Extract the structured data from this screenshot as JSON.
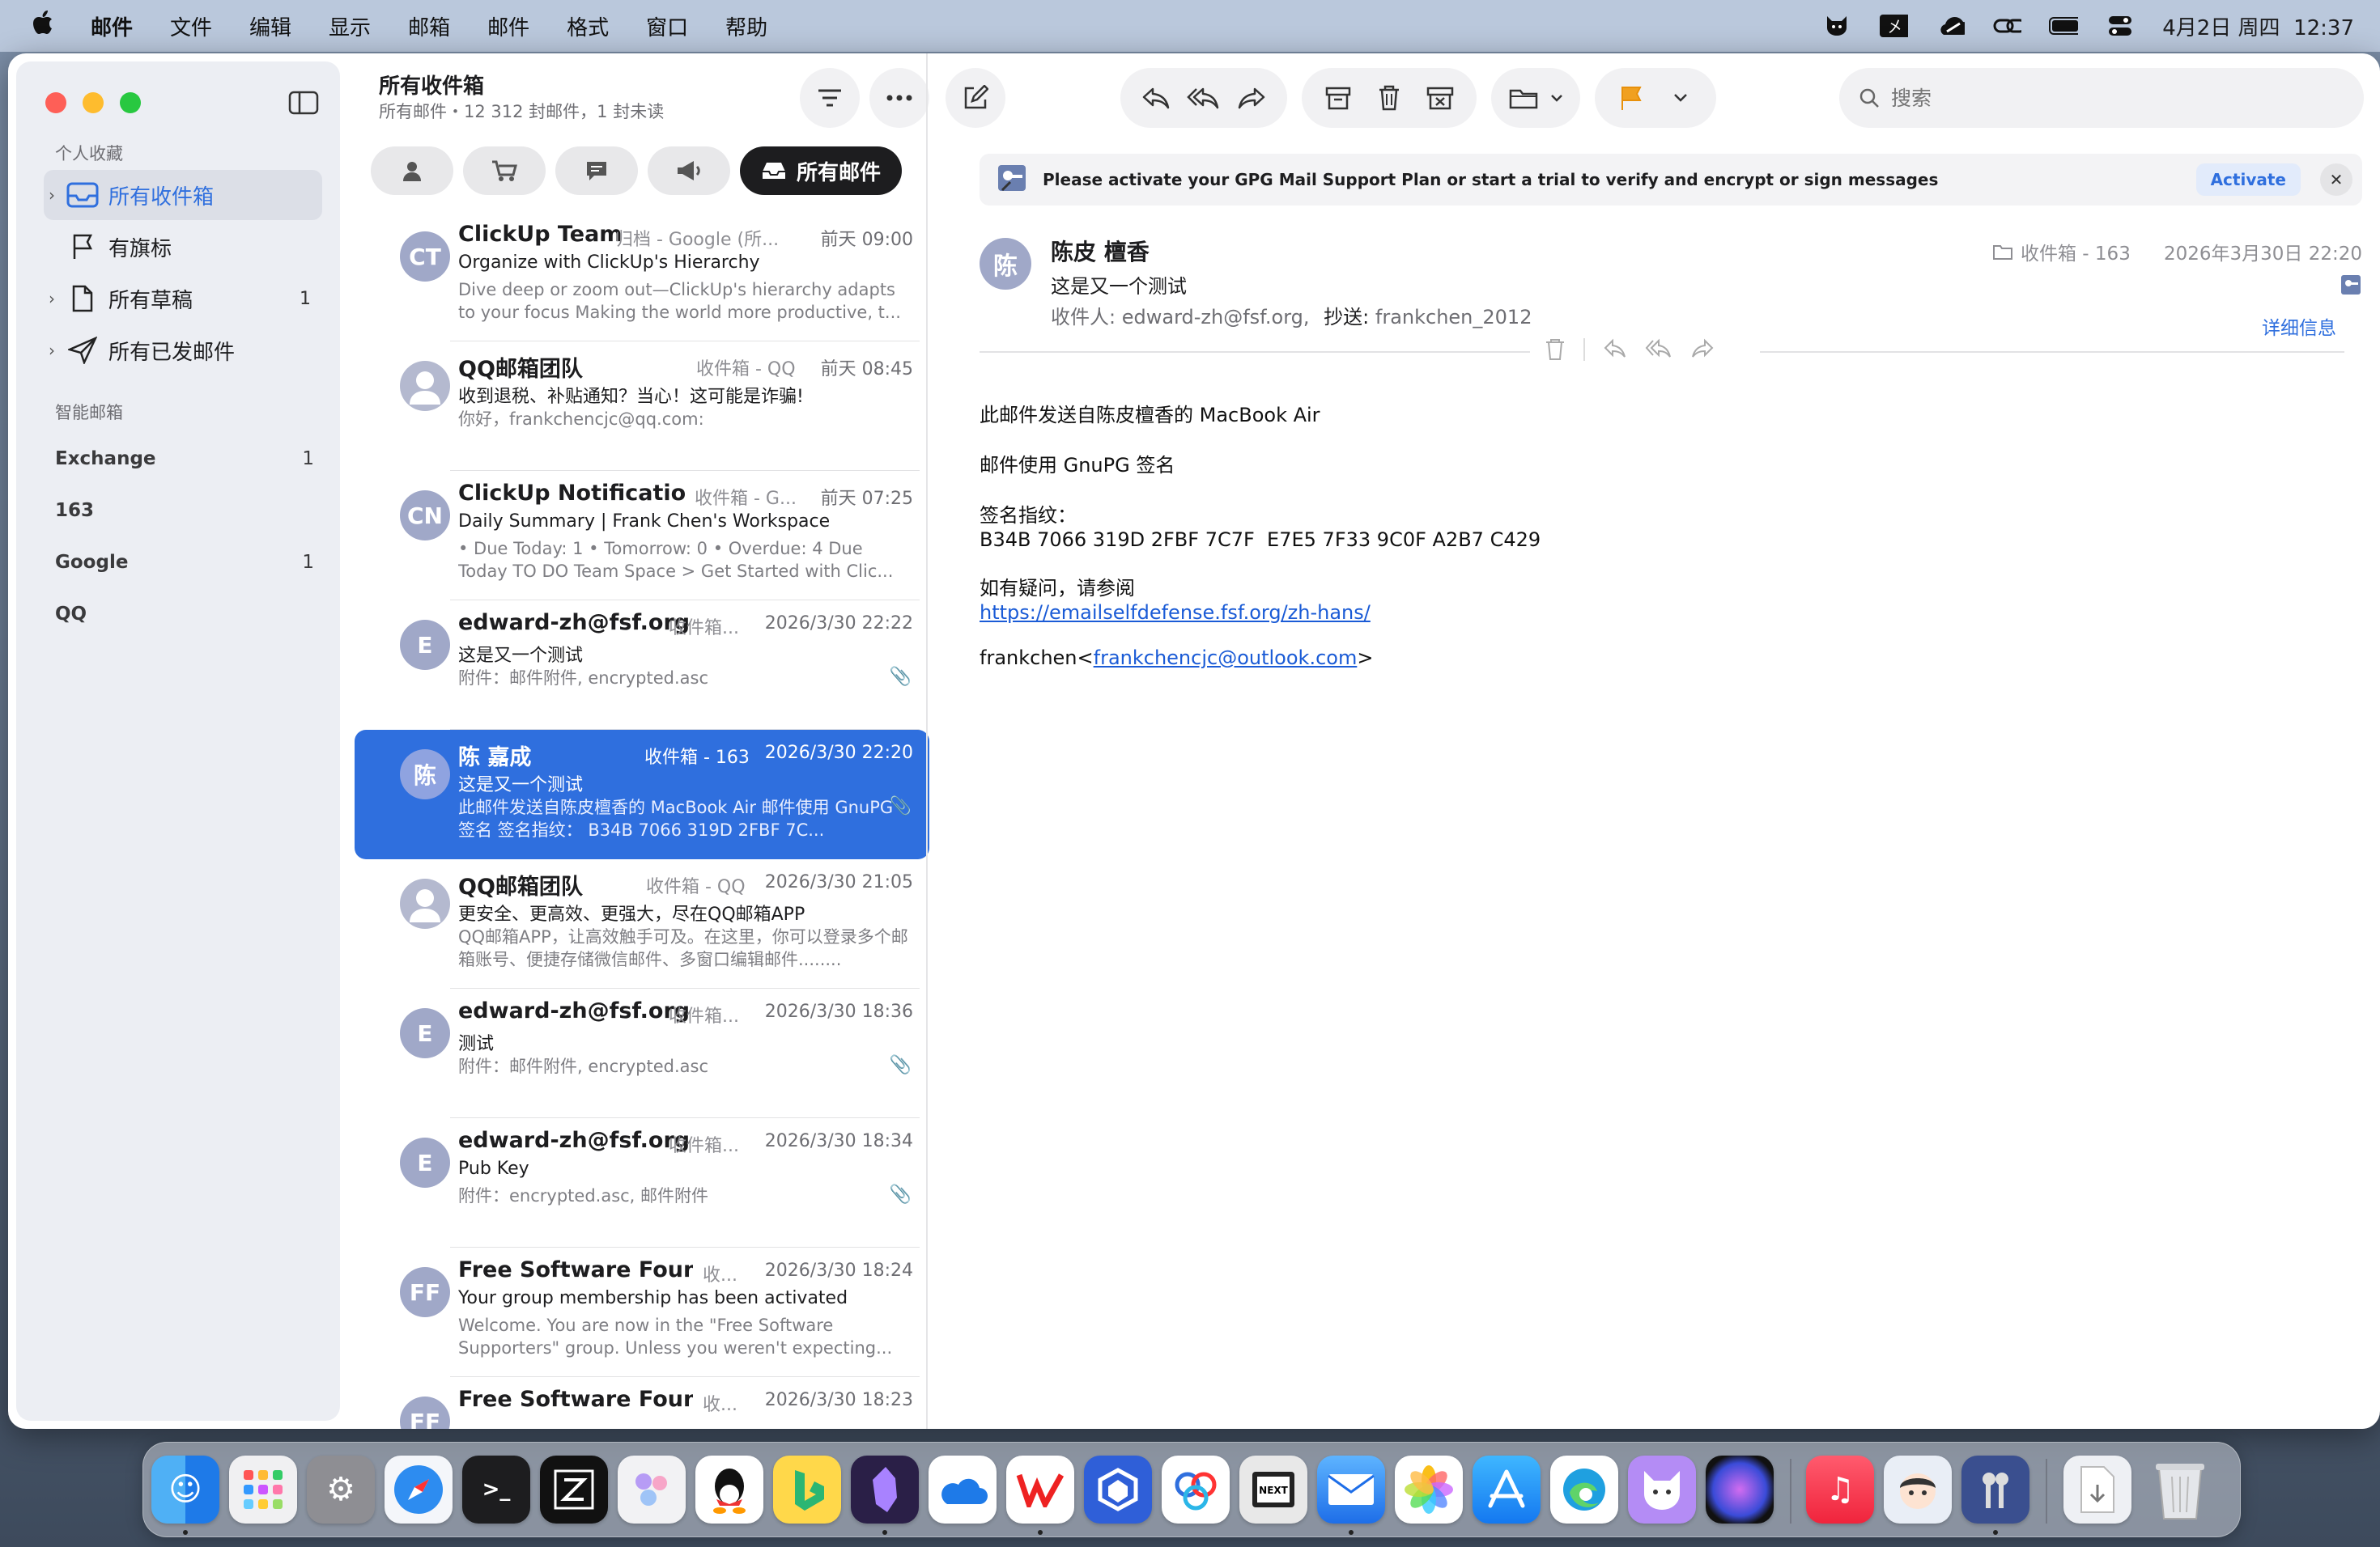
{
  "menubar": {
    "apple": "",
    "items": [
      "邮件",
      "文件",
      "编辑",
      "显示",
      "邮箱",
      "邮件",
      "格式",
      "窗口",
      "帮助"
    ],
    "datetime": "4月2日 周四  12:37",
    "status_icons": [
      "cat-icon",
      "input-method-icon",
      "cloud-icon",
      "link-icon",
      "battery-icon",
      "control-center-icon"
    ]
  },
  "sidebar": {
    "favorites_header": "个人收藏",
    "favorites": [
      {
        "label": "所有收件箱",
        "count": "",
        "icon": "inbox-icon"
      },
      {
        "label": "有旗标",
        "count": "",
        "icon": "flag-icon"
      },
      {
        "label": "所有草稿",
        "count": "1",
        "icon": "document-icon"
      },
      {
        "label": "所有已发邮件",
        "count": "",
        "icon": "paperplane-icon"
      }
    ],
    "smart_header": "智能邮箱",
    "accounts": [
      {
        "label": "Exchange",
        "count": "1"
      },
      {
        "label": "163",
        "count": ""
      },
      {
        "label": "Google",
        "count": "1"
      },
      {
        "label": "QQ",
        "count": ""
      }
    ]
  },
  "list": {
    "title": "所有收件箱",
    "subtitle": "所有邮件・12 312 封邮件，1 封未读",
    "active_category": "所有邮件",
    "categories": [
      "person-icon",
      "cart-icon",
      "chat-icon",
      "megaphone-icon",
      "inbox-tray-icon"
    ],
    "messages": [
      {
        "avatar": "CT",
        "from": "ClickUp Team",
        "mailbox": "归档 - Google (所...",
        "date": "前天 09:00",
        "subject": "Organize with ClickUp's Hierarchy",
        "preview": "Dive deep or zoom out—ClickUp's hierarchy adapts to your focus Making the world more productive, t...",
        "attachment": false
      },
      {
        "avatar": "",
        "from": "QQ邮箱团队",
        "mailbox": "收件箱 - QQ",
        "date": "前天 08:45",
        "subject": "收到退税、补贴通知？当心！这可能是诈骗!",
        "preview": "你好，frankchencjc@qq.com:",
        "attachment": false
      },
      {
        "avatar": "CN",
        "from": "ClickUp Notifications",
        "mailbox": "收件箱 - G...",
        "date": "前天 07:25",
        "subject": "Daily Summary | Frank Chen's Workspace",
        "preview": "• Due Today: 1 • Tomorrow: 0 • Overdue: 4 Due Today TO DO Team Space > Get Started with Clic...",
        "attachment": false
      },
      {
        "avatar": "E",
        "from": "edward-zh@fsf.org",
        "mailbox": "收件箱...",
        "date": "2026/3/30 22:22",
        "subject": "这是又一个测试",
        "preview": "附件：邮件附件, encrypted.asc",
        "attachment": true
      },
      {
        "avatar": "陈",
        "from": "陈 嘉成",
        "mailbox": "收件箱 - 163",
        "date": "2026/3/30 22:20",
        "subject": "这是又一个测试",
        "preview": "此邮件发送自陈皮檀香的 MacBook Air 邮件使用 GnuPG 签名 签名指纹： B34B 7066 319D 2FBF 7C...",
        "attachment": true
      },
      {
        "avatar": "",
        "from": "QQ邮箱团队",
        "mailbox": "收件箱 - QQ",
        "date": "2026/3/30 21:05",
        "subject": "更安全、更高效、更强大，尽在QQ邮箱APP",
        "preview": "QQ邮箱APP，让高效触手可及。在这里，你可以登录多个邮箱账号、便捷存储微信邮件、多窗口编辑邮件........",
        "attachment": false
      },
      {
        "avatar": "E",
        "from": "edward-zh@fsf.org",
        "mailbox": "收件箱...",
        "date": "2026/3/30 18:36",
        "subject": "测试",
        "preview": "附件：邮件附件, encrypted.asc",
        "attachment": true
      },
      {
        "avatar": "E",
        "from": "edward-zh@fsf.org",
        "mailbox": "收件箱...",
        "date": "2026/3/30 18:34",
        "subject": "Pub Key",
        "preview": "附件：encrypted.asc, 邮件附件",
        "attachment": true
      },
      {
        "avatar": "FF",
        "from": "Free Software Foun...",
        "mailbox": "收...",
        "date": "2026/3/30 18:24",
        "subject": "Your group membership has been activated",
        "preview": "Welcome. You are now in the \"Free Software Supporters\" group. Unless you weren't expecting...",
        "attachment": false
      },
      {
        "avatar": "FF",
        "from": "Free Software Foun...",
        "mailbox": "收...",
        "date": "2026/3/30 18:23",
        "subject": "",
        "preview": "",
        "attachment": false
      }
    ]
  },
  "reader": {
    "search_placeholder": "搜索",
    "banner": {
      "text": "Please activate your GPG Mail Support Plan or start a trial to verify and encrypt or sign messages",
      "action": "Activate"
    },
    "message": {
      "avatar": "陈",
      "from": "陈皮 檀香",
      "subject": "这是又一个测试",
      "to_label": "收件人:",
      "to": "edward-zh@fsf.org,",
      "cc_label": "抄送:",
      "cc": "frankchen_2012",
      "mailbox": "收件箱 - 163",
      "date": "2026年3月30日 22:20",
      "details": "详细信息",
      "body": {
        "l1": "此邮件发送自陈皮檀香的 MacBook Air",
        "l2": "邮件使用 GnuPG 签名",
        "l3": "签名指纹：",
        "l4": "B34B 7066 319D 2FBF 7C7F  E7E5 7F33 9C0F A2B7 C429",
        "l5": "如有疑问，请参阅",
        "link": "https://emailselfdefense.fsf.org/zh-hans/",
        "sig_name": "frankchen<",
        "sig_email": "frankchencjc@outlook.com",
        "sig_end": ">"
      }
    }
  },
  "colors": {
    "accent": "#2f6fde",
    "flag": "#f0a020"
  },
  "dock": [
    "Finder",
    "Launchpad",
    "System Settings",
    "Safari",
    "Terminal",
    "Zed",
    "Craft",
    "QQ",
    "Bing",
    "Obsidian",
    "OneDrive",
    "WPS",
    "Tencent",
    "Baidu",
    "NetNewsWire",
    "Mail",
    "Photos",
    "App Store",
    "Edge",
    "Cat",
    "Siri",
    "Music",
    "Avatar",
    "Keychain",
    "Downloads",
    "Trash"
  ]
}
